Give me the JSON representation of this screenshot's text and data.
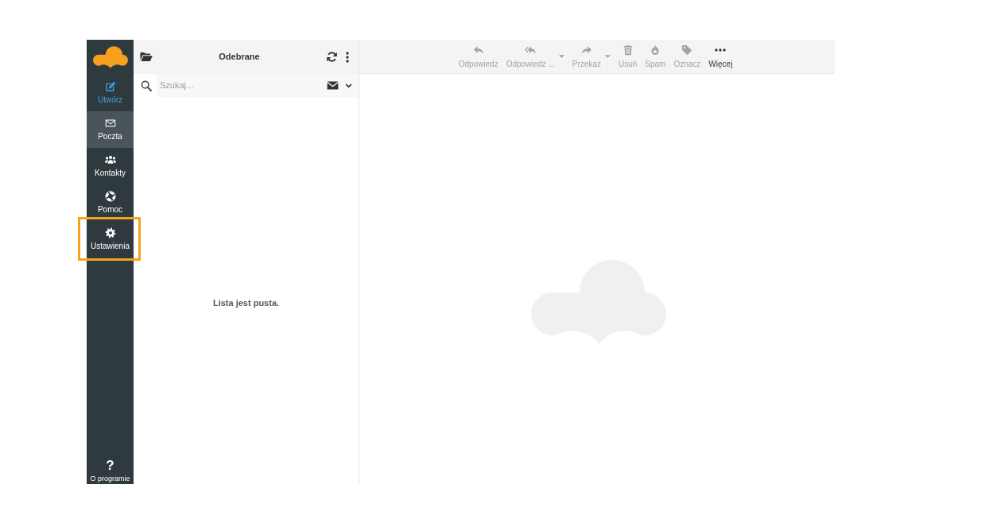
{
  "sidebar": {
    "items": [
      {
        "label": "Utwórz",
        "kind": "primary",
        "selected": false,
        "highlighted": false
      },
      {
        "label": "Poczta",
        "kind": "nav",
        "selected": true,
        "highlighted": false
      },
      {
        "label": "Kontakty",
        "kind": "nav",
        "selected": false,
        "highlighted": false
      },
      {
        "label": "Pomoc",
        "kind": "nav",
        "selected": false,
        "highlighted": false
      },
      {
        "label": "Ustawienia",
        "kind": "nav",
        "selected": false,
        "highlighted": true
      }
    ],
    "footer": {
      "symbol": "?",
      "label": "O programie"
    }
  },
  "mail_list": {
    "folder": "Odebrane",
    "search": {
      "placeholder": "Szukaj..."
    },
    "empty_message": "Lista jest pusta."
  },
  "toolbar": {
    "buttons": [
      {
        "label": "Odpowiedz",
        "disabled": true,
        "dropdown": false
      },
      {
        "label": "Odpowiedz ...",
        "disabled": true,
        "dropdown": true
      },
      {
        "label": "Przekaż",
        "disabled": true,
        "dropdown": true
      },
      {
        "label": "Usuń",
        "disabled": true,
        "dropdown": false
      },
      {
        "label": "Spam",
        "disabled": true,
        "dropdown": false
      },
      {
        "label": "Oznacz",
        "disabled": true,
        "dropdown": false
      },
      {
        "label": "Więcej",
        "disabled": false,
        "dropdown": false
      }
    ]
  }
}
